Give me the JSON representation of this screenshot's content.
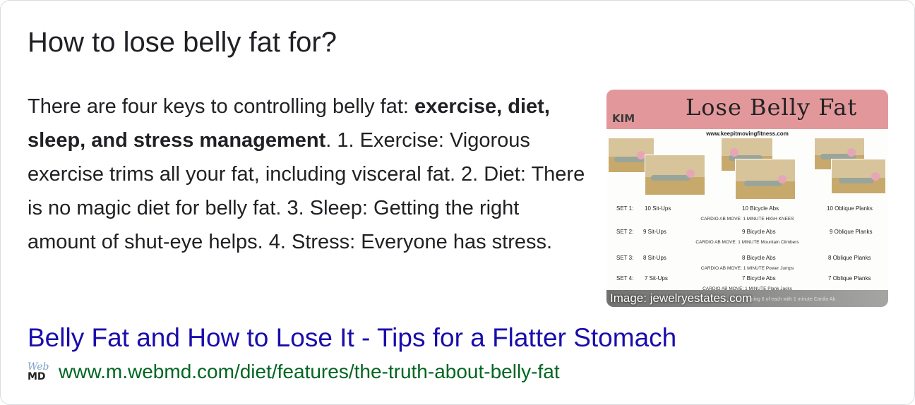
{
  "question": "How to lose belly fat for?",
  "answer": {
    "intro": "There are four keys to controlling belly fat: ",
    "bold": "exercise, diet, sleep, and stress management",
    "rest": ". 1. Exercise: Vigorous exercise trims all your fat, including visceral fat. 2. Diet: There is no magic diet for belly fat. 3. Sleep: Getting the right amount of shut-eye helps. 4. Stress: Everyone has stress."
  },
  "thumbnail": {
    "title": "Lose Belly Fat",
    "logo": "KIM",
    "site": "www.keepitmovingfitness.com",
    "sets": [
      {
        "label": "SET 1:",
        "a": "10 Sit-Ups",
        "b": "10 Bicycle Abs",
        "c": "10 Oblique Planks",
        "cardio": "CARDIO AB MOVE: 1 MINUTE  HIGH KNEES"
      },
      {
        "label": "SET 2:",
        "a": "9 Sit-Ups",
        "b": "9 Bicycle Abs",
        "c": "9 Oblique Planks",
        "cardio": "CARDIO AB MOVE: 1 MINUTE  Mountain Climbers"
      },
      {
        "label": "SET 3:",
        "a": "8 Sit-Ups",
        "b": "8 Bicycle Abs",
        "c": "8 Oblique Planks",
        "cardio": "CARDIO AB MOVE: 1 MINUTE  Power Jumps"
      },
      {
        "label": "SET 4:",
        "a": "7 Sit-Ups",
        "b": "7 Bicycle Abs",
        "c": "7 Oblique Planks",
        "cardio": "CARDIO AB MOVE: 1 MINUTE  Plank Jacks"
      }
    ],
    "footer_fragment": "oing 6 of each with 1 minute Cardio Ab",
    "credit": "Image: jewelryestates.com",
    "banner_color": "#e2989b"
  },
  "result": {
    "title": "Belly Fat and How to Lose It - Tips for a Flatter Stomach",
    "url": "www.m.webmd.com/diet/features/the-truth-about-belly-fat",
    "favicon_top": "Web",
    "favicon_bottom": "MD",
    "link_color": "#1a0dab",
    "url_color": "#006621"
  }
}
